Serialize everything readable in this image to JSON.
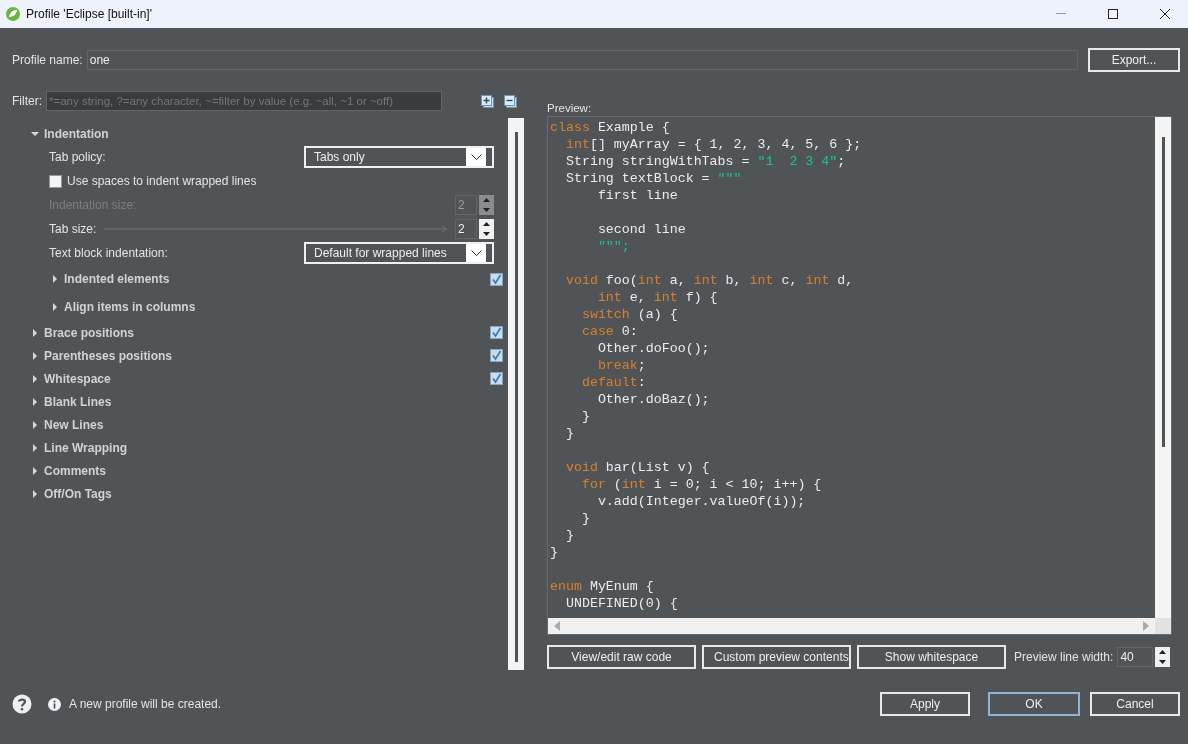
{
  "window": {
    "title": "Profile 'Eclipse [built-in]'"
  },
  "profile": {
    "label": "Profile name:",
    "value": "one",
    "export": "Export..."
  },
  "filter": {
    "label": "Filter:",
    "placeholder": "*=any string, ?=any character, ~=filter by value (e.g. ~all, ~1 or ~off)"
  },
  "sections": [
    {
      "label": "Indentation",
      "expanded": true,
      "changed": false,
      "children": [
        {
          "kind": "select",
          "label": "Tab policy:",
          "value": "Tabs only",
          "disabled": false
        },
        {
          "kind": "checkbox",
          "label": "Use spaces to indent wrapped lines",
          "checked": false,
          "disabled": false
        },
        {
          "kind": "spinner",
          "label": "Indentation size:",
          "value": "2",
          "disabled": true,
          "leader": false
        },
        {
          "kind": "spinner",
          "label": "Tab size:",
          "value": "2",
          "disabled": false,
          "leader": true
        },
        {
          "kind": "select",
          "label": "Text block indentation:",
          "value": "Default for wrapped lines",
          "disabled": false
        },
        {
          "kind": "group",
          "label": "Indented elements",
          "expanded": false,
          "changed": true
        },
        {
          "kind": "group",
          "label": "Align items in columns",
          "expanded": false,
          "changed": false
        }
      ]
    },
    {
      "label": "Brace positions",
      "expanded": false,
      "changed": true
    },
    {
      "label": "Parentheses positions",
      "expanded": false,
      "changed": true
    },
    {
      "label": "Whitespace",
      "expanded": false,
      "changed": true
    },
    {
      "label": "Blank Lines",
      "expanded": false,
      "changed": false
    },
    {
      "label": "New Lines",
      "expanded": false,
      "changed": false
    },
    {
      "label": "Line Wrapping",
      "expanded": false,
      "changed": false
    },
    {
      "label": "Comments",
      "expanded": false,
      "changed": false
    },
    {
      "label": "Off/On Tags",
      "expanded": false,
      "changed": false
    }
  ],
  "preview": {
    "label": "Preview:",
    "lines": [
      {
        "kind": "code",
        "tokens": [
          {
            "kind": "kw",
            "text": "class"
          },
          {
            "kind": "plain",
            "text": " Example {"
          }
        ]
      },
      {
        "kind": "code",
        "tokens": [
          {
            "kind": "kw",
            "text": "  int"
          },
          {
            "kind": "plain",
            "text": "[] myArray = { 1, 2, 3, 4, 5, 6 };"
          }
        ]
      },
      {
        "kind": "code",
        "tokens": [
          {
            "kind": "plain",
            "text": "  String stringWithTabs = "
          },
          {
            "kind": "str",
            "text": "\"1  2 3 4\""
          },
          {
            "kind": "plain",
            "text": ";"
          }
        ]
      },
      {
        "kind": "code",
        "tokens": [
          {
            "kind": "plain",
            "text": "  String textBlock = "
          },
          {
            "kind": "str",
            "text": "\"\"\""
          }
        ]
      },
      {
        "kind": "code",
        "tokens": [
          {
            "kind": "plain",
            "text": "      first line"
          }
        ]
      },
      {
        "kind": "blank"
      },
      {
        "kind": "code",
        "tokens": [
          {
            "kind": "plain",
            "text": "      second line"
          }
        ]
      },
      {
        "kind": "code",
        "tokens": [
          {
            "kind": "str",
            "text": "      \"\"\";"
          }
        ]
      },
      {
        "kind": "blank"
      },
      {
        "kind": "code",
        "tokens": [
          {
            "kind": "kw",
            "text": "  void"
          },
          {
            "kind": "plain",
            "text": " foo("
          },
          {
            "kind": "kw",
            "text": "int"
          },
          {
            "kind": "plain",
            "text": " a, "
          },
          {
            "kind": "kw",
            "text": "int"
          },
          {
            "kind": "plain",
            "text": " b, "
          },
          {
            "kind": "kw",
            "text": "int"
          },
          {
            "kind": "plain",
            "text": " c, "
          },
          {
            "kind": "kw",
            "text": "int"
          },
          {
            "kind": "plain",
            "text": " d,"
          }
        ]
      },
      {
        "kind": "code",
        "tokens": [
          {
            "kind": "kw",
            "text": "      int"
          },
          {
            "kind": "plain",
            "text": " e, "
          },
          {
            "kind": "kw",
            "text": "int"
          },
          {
            "kind": "plain",
            "text": " f) {"
          }
        ]
      },
      {
        "kind": "code",
        "tokens": [
          {
            "kind": "kw",
            "text": "    switch"
          },
          {
            "kind": "plain",
            "text": " (a) {"
          }
        ]
      },
      {
        "kind": "code",
        "tokens": [
          {
            "kind": "kw",
            "text": "    case"
          },
          {
            "kind": "plain",
            "text": " 0:"
          }
        ]
      },
      {
        "kind": "code",
        "tokens": [
          {
            "kind": "plain",
            "text": "      Other.doFoo();"
          }
        ]
      },
      {
        "kind": "code",
        "tokens": [
          {
            "kind": "kw",
            "text": "      break"
          },
          {
            "kind": "plain",
            "text": ";"
          }
        ]
      },
      {
        "kind": "code",
        "tokens": [
          {
            "kind": "kw",
            "text": "    default"
          },
          {
            "kind": "plain",
            "text": ":"
          }
        ]
      },
      {
        "kind": "code",
        "tokens": [
          {
            "kind": "plain",
            "text": "      Other.doBaz();"
          }
        ]
      },
      {
        "kind": "code",
        "tokens": [
          {
            "kind": "plain",
            "text": "    }"
          }
        ]
      },
      {
        "kind": "code",
        "tokens": [
          {
            "kind": "plain",
            "text": "  }"
          }
        ]
      },
      {
        "kind": "blank"
      },
      {
        "kind": "code",
        "tokens": [
          {
            "kind": "kw",
            "text": "  void"
          },
          {
            "kind": "plain",
            "text": " bar(List v) {"
          }
        ]
      },
      {
        "kind": "code",
        "tokens": [
          {
            "kind": "kw",
            "text": "    for"
          },
          {
            "kind": "plain",
            "text": " ("
          },
          {
            "kind": "kw",
            "text": "int"
          },
          {
            "kind": "plain",
            "text": " i = 0; i < 10; i++) {"
          }
        ]
      },
      {
        "kind": "code",
        "tokens": [
          {
            "kind": "plain",
            "text": "      v.add(Integer.valueOf(i));"
          }
        ]
      },
      {
        "kind": "code",
        "tokens": [
          {
            "kind": "plain",
            "text": "    }"
          }
        ]
      },
      {
        "kind": "code",
        "tokens": [
          {
            "kind": "plain",
            "text": "  }"
          }
        ]
      },
      {
        "kind": "code",
        "tokens": [
          {
            "kind": "plain",
            "text": "}"
          }
        ]
      },
      {
        "kind": "blank"
      },
      {
        "kind": "code",
        "tokens": [
          {
            "kind": "kw",
            "text": "enum"
          },
          {
            "kind": "plain",
            "text": " MyEnum {"
          }
        ]
      },
      {
        "kind": "code",
        "tokens": [
          {
            "kind": "plain",
            "text": "  UNDEFINED(0) {"
          }
        ]
      }
    ],
    "buttons": [
      "View/edit raw code",
      "Custom preview contents",
      "Show whitespace"
    ],
    "line_width": {
      "label": "Preview line width:",
      "value": "40"
    }
  },
  "status": {
    "message": "A new profile will be created."
  },
  "dialog_buttons": [
    {
      "label": "Apply",
      "focused": false
    },
    {
      "label": "OK",
      "focused": true
    },
    {
      "label": "Cancel",
      "focused": false
    }
  ]
}
